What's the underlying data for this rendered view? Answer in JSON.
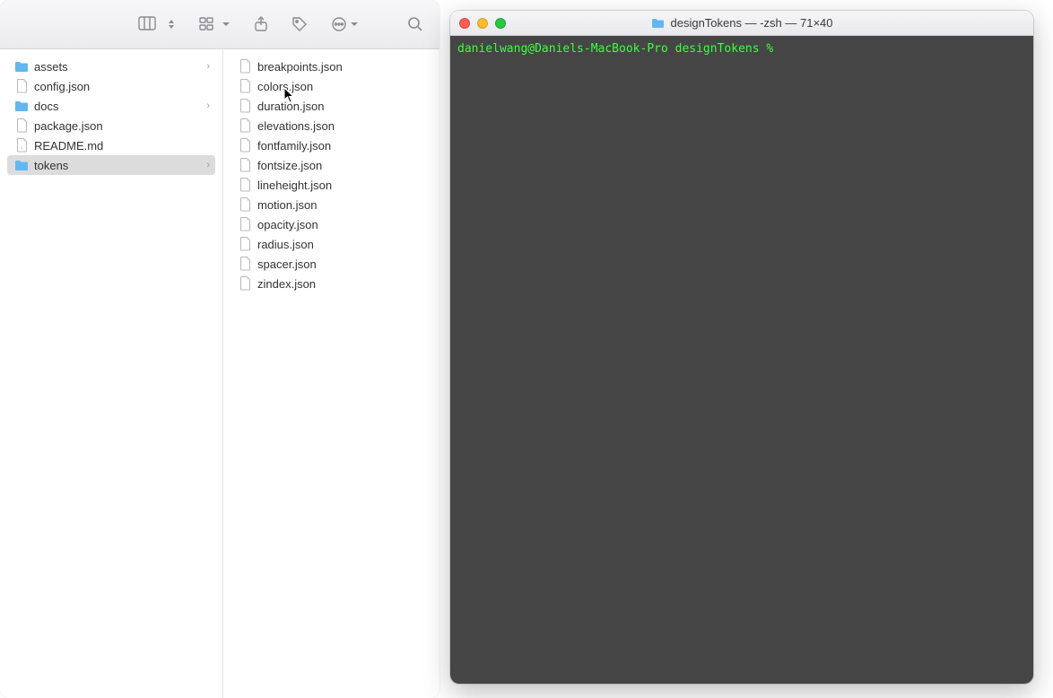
{
  "finder": {
    "col1": [
      {
        "name": "assets",
        "type": "folder",
        "expandable": true
      },
      {
        "name": "config.json",
        "type": "file",
        "expandable": false
      },
      {
        "name": "docs",
        "type": "folder",
        "expandable": true
      },
      {
        "name": "package.json",
        "type": "file",
        "expandable": false
      },
      {
        "name": "README.md",
        "type": "md",
        "expandable": false
      },
      {
        "name": "tokens",
        "type": "folder",
        "expandable": true,
        "selected": true
      }
    ],
    "col2": [
      {
        "name": "breakpoints.json",
        "type": "file"
      },
      {
        "name": "colors.json",
        "type": "file"
      },
      {
        "name": "duration.json",
        "type": "file"
      },
      {
        "name": "elevations.json",
        "type": "file"
      },
      {
        "name": "fontfamily.json",
        "type": "file"
      },
      {
        "name": "fontsize.json",
        "type": "file"
      },
      {
        "name": "lineheight.json",
        "type": "file"
      },
      {
        "name": "motion.json",
        "type": "file"
      },
      {
        "name": "opacity.json",
        "type": "file"
      },
      {
        "name": "radius.json",
        "type": "file"
      },
      {
        "name": "spacer.json",
        "type": "file"
      },
      {
        "name": "zindex.json",
        "type": "file"
      }
    ]
  },
  "terminal": {
    "title": "designTokens — -zsh — 71×40",
    "title_icon": "folder",
    "prompt": "danielwang@Daniels-MacBook-Pro designTokens % "
  }
}
